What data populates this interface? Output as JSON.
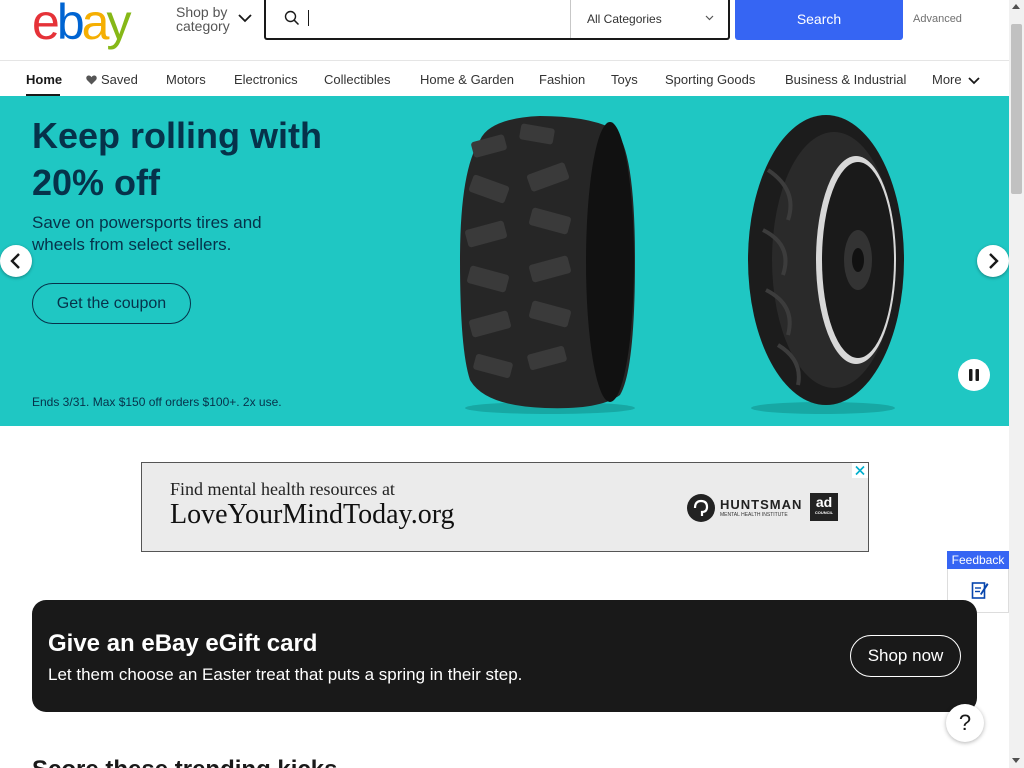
{
  "header": {
    "logo": {
      "letters": [
        "e",
        "b",
        "a",
        "y"
      ],
      "colors": [
        "#e53238",
        "#0064d2",
        "#f5af02",
        "#86b817"
      ]
    },
    "shop_by_category": [
      "Shop by",
      "category"
    ],
    "search": {
      "placeholder": "",
      "value": ""
    },
    "category_select": "All Categories",
    "search_button": "Search",
    "advanced_link": "Advanced"
  },
  "nav": {
    "items": [
      "Home",
      "Saved",
      "Motors",
      "Electronics",
      "Collectibles",
      "Home & Garden",
      "Fashion",
      "Toys",
      "Sporting Goods",
      "Business & Industrial",
      "More"
    ]
  },
  "hero": {
    "title": "Keep rolling with 20% off",
    "subtitle": "Save on powersports tires and wheels from select sellers.",
    "button": "Get the coupon",
    "fine_print": "Ends 3/31. Max $150 off orders $100+. 2x use.",
    "background": "#1fc7c3"
  },
  "ad": {
    "line1": "Find mental health resources at",
    "line2": "LoveYourMindToday.org",
    "sponsor_name": "HUNTSMAN",
    "sponsor_sub": "MENTAL HEALTH INSTITUTE",
    "council_top": "ad",
    "council_bottom": "COUNCIL"
  },
  "feedback": {
    "label": "Feedback"
  },
  "gift_card": {
    "title": "Give an eBay eGift card",
    "subtitle": "Let them choose an Easter treat that puts a spring in their step.",
    "button": "Shop now"
  },
  "help": {
    "label": "?"
  },
  "next_section": {
    "heading": "Score these trending kicks"
  },
  "colors": {
    "accent": "#3665f3",
    "dark": "#191919",
    "hero_text": "#06324a"
  }
}
